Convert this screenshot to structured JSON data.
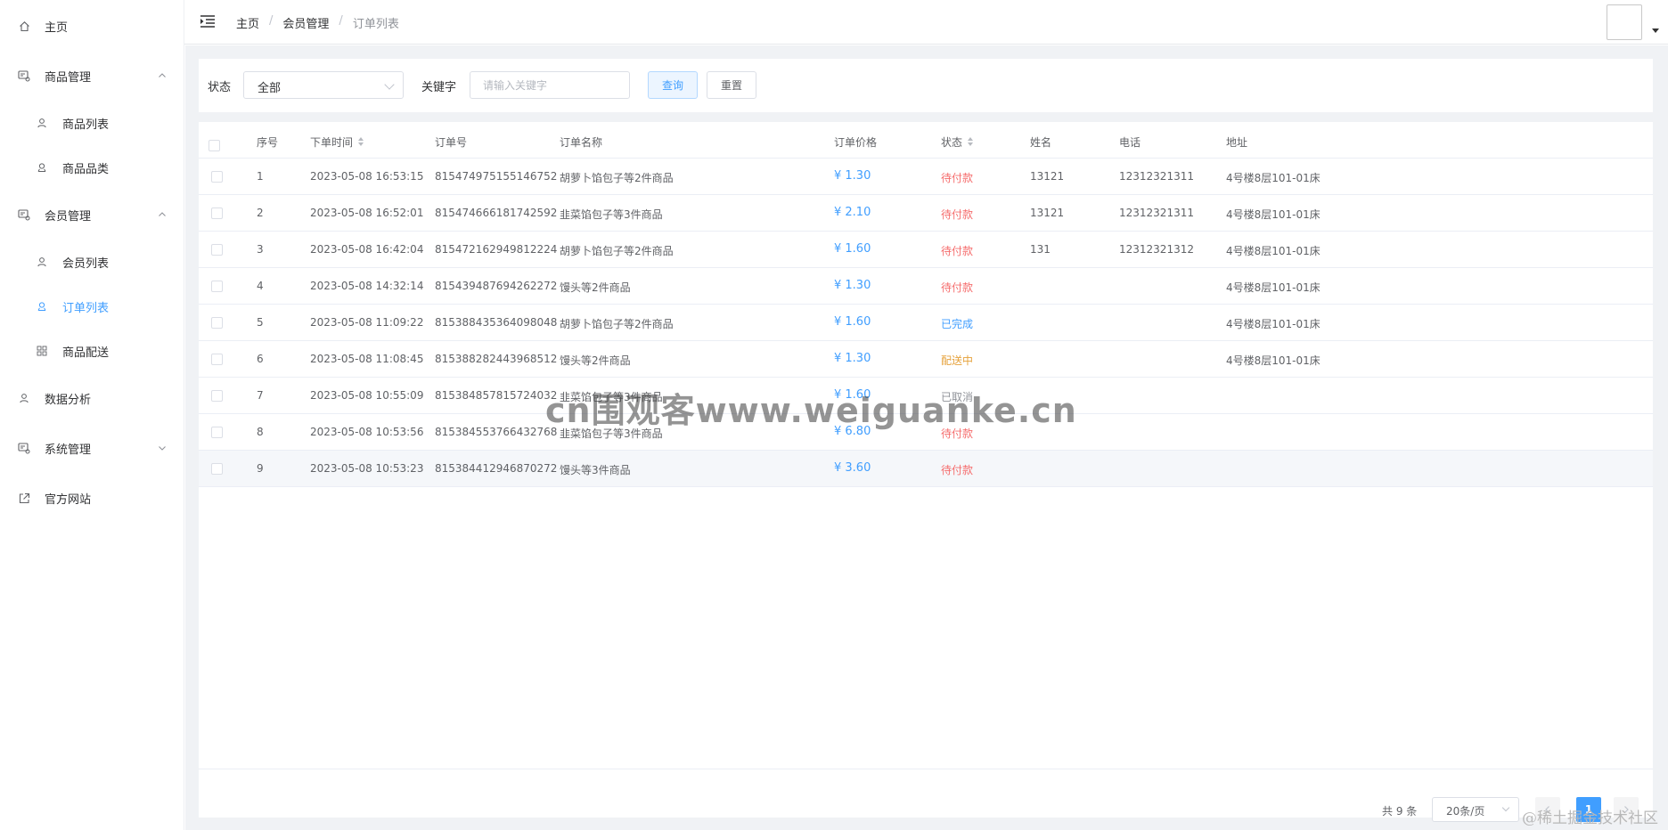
{
  "sidebar": {
    "items": [
      {
        "label": "主页",
        "icon": "home-icon"
      },
      {
        "label": "商品管理",
        "icon": "goods-icon"
      },
      {
        "label": "商品列表",
        "icon": "user-icon"
      },
      {
        "label": "商品品类",
        "icon": "users-icon"
      },
      {
        "label": "会员管理",
        "icon": "goods-icon"
      },
      {
        "label": "会员列表",
        "icon": "user-icon"
      },
      {
        "label": "订单列表",
        "icon": "users-icon"
      },
      {
        "label": "商品配送",
        "icon": "grid-icon"
      },
      {
        "label": "数据分析",
        "icon": "user-icon"
      },
      {
        "label": "系统管理",
        "icon": "goods-icon"
      },
      {
        "label": "官方网站",
        "icon": "external-link-icon"
      }
    ]
  },
  "header": {
    "breadcrumb": [
      "主页",
      "会员管理",
      "订单列表"
    ],
    "separator": "/"
  },
  "filter": {
    "status_label": "状态",
    "status_value": "全部",
    "keyword_label": "关键字",
    "keyword_placeholder": "请输入关键字",
    "query_label": "查询",
    "reset_label": "重置"
  },
  "table": {
    "columns": [
      "序号",
      "下单时间",
      "订单号",
      "订单名称",
      "订单价格",
      "状态",
      "姓名",
      "电话",
      "地址"
    ],
    "rows": [
      {
        "no": "1",
        "time": "2023-05-08 16:53:15",
        "order_no": "815474975155146752",
        "name": "胡萝卜馅包子等2件商品",
        "price": "¥ 1.30",
        "status": "待付款",
        "customer": "13121",
        "phone": "12312321311",
        "address": "4号楼8层101-01床"
      },
      {
        "no": "2",
        "time": "2023-05-08 16:52:01",
        "order_no": "815474666181742592",
        "name": "韭菜馅包子等3件商品",
        "price": "¥ 2.10",
        "status": "待付款",
        "customer": "13121",
        "phone": "12312321311",
        "address": "4号楼8层101-01床"
      },
      {
        "no": "3",
        "time": "2023-05-08 16:42:04",
        "order_no": "815472162949812224",
        "name": "胡萝卜馅包子等2件商品",
        "price": "¥ 1.60",
        "status": "待付款",
        "customer": "131",
        "phone": "12312321312",
        "address": "4号楼8层101-01床"
      },
      {
        "no": "4",
        "time": "2023-05-08 14:32:14",
        "order_no": "815439487694262272",
        "name": "馒头等2件商品",
        "price": "¥ 1.30",
        "status": "待付款",
        "customer": "",
        "phone": "",
        "address": "4号楼8层101-01床"
      },
      {
        "no": "5",
        "time": "2023-05-08 11:09:22",
        "order_no": "815388435364098048",
        "name": "胡萝卜馅包子等2件商品",
        "price": "¥ 1.60",
        "status": "已完成",
        "customer": "",
        "phone": "",
        "address": "4号楼8层101-01床"
      },
      {
        "no": "6",
        "time": "2023-05-08 11:08:45",
        "order_no": "815388282443968512",
        "name": "馒头等2件商品",
        "price": "¥ 1.30",
        "status": "配送中",
        "customer": "",
        "phone": "",
        "address": "4号楼8层101-01床"
      },
      {
        "no": "7",
        "time": "2023-05-08 10:55:09",
        "order_no": "815384857815724032",
        "name": "韭菜馅包子等3件商品",
        "price": "¥ 1.60",
        "status": "已取消",
        "customer": "",
        "phone": "",
        "address": ""
      },
      {
        "no": "8",
        "time": "2023-05-08 10:53:56",
        "order_no": "815384553766432768",
        "name": "韭菜馅包子等3件商品",
        "price": "¥ 6.80",
        "status": "待付款",
        "customer": "",
        "phone": "",
        "address": ""
      },
      {
        "no": "9",
        "time": "2023-05-08 10:53:23",
        "order_no": "815384412946870272",
        "name": "馒头等3件商品",
        "price": "¥ 3.60",
        "status": "待付款",
        "customer": "",
        "phone": "",
        "address": ""
      }
    ]
  },
  "pagination": {
    "total": "共 9 条",
    "page_size": "20条/页",
    "current_page": "1",
    "prev_icon": "chevron-left-icon",
    "next_icon": "chevron-right-icon"
  },
  "watermark": "cn围观客www.weiguanke.cn",
  "corner_watermark": "@稀土掘金技术社区",
  "colors": {
    "accent": "#409eff",
    "pending": "#f56c6c",
    "shipping": "#e6a23c",
    "cancelled": "#909399"
  }
}
